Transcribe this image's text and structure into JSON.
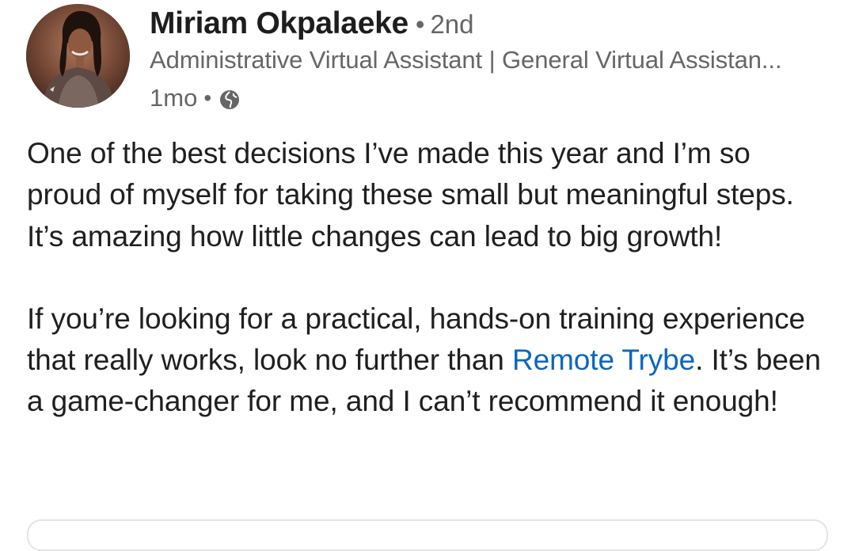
{
  "author": {
    "name": "Miriam Okpalaeke",
    "separator": "•",
    "degree": "2nd",
    "headline": "Administrative Virtual Assistant | General Virtual Assistan...",
    "timestamp": "1mo",
    "meta_separator": "•",
    "visibility_icon": "globe-icon"
  },
  "post": {
    "paragraph1": "One of the best decisions I’ve made this year and I’m so proud of myself for taking these small but meaningful steps. It’s amazing how little changes can lead to big growth!",
    "paragraph2_before": "If you’re looking for a practical, hands-on training experience that really works, look no further than ",
    "mention": "Remote Trybe",
    "paragraph2_after": ". It’s been a game-changer for me, and I can’t recommend it enough!"
  },
  "colors": {
    "mention": "#0a66c2",
    "text": "#1f1f1f",
    "secondary_text": "#666666"
  }
}
